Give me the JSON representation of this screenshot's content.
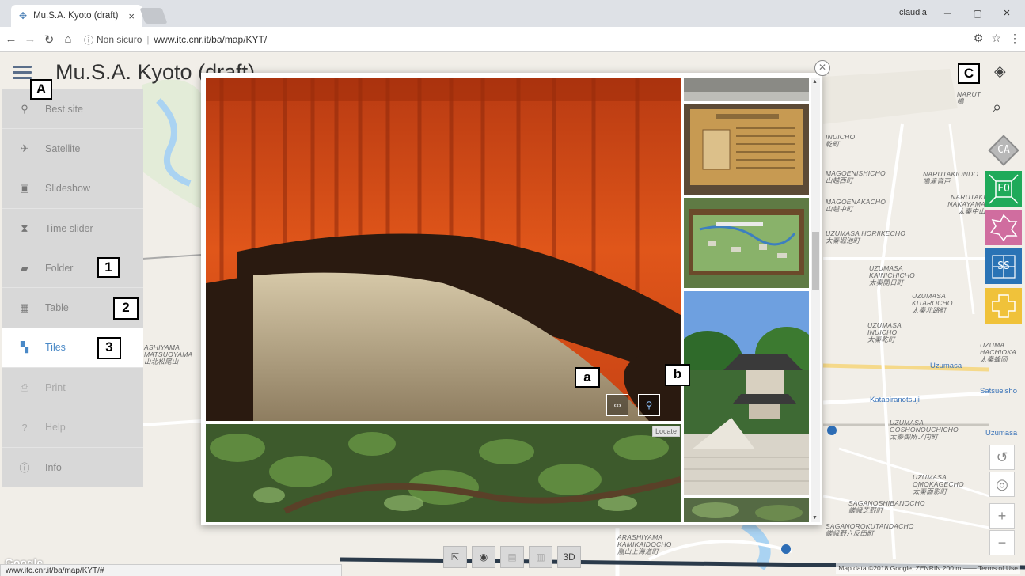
{
  "browser": {
    "tab_title": "Mu.S.A. Kyoto (draft)",
    "tab_close": "×",
    "user_name": "claudia",
    "minimize": "–",
    "restore": "▢",
    "close": "×",
    "security_label": "Non sicuro",
    "url": "www.itc.cnr.it/ba/map/KYT/",
    "status_url": "www.itc.cnr.it/ba/map/KYT/#"
  },
  "app": {
    "title": "Mu.S.A. Kyoto (draft)"
  },
  "sidebar": {
    "items": [
      {
        "label": "Best site",
        "icon": "pin-icon"
      },
      {
        "label": "Satellite",
        "icon": "satellite-icon"
      },
      {
        "label": "Slideshow",
        "icon": "slideshow-icon"
      },
      {
        "label": "Time slider",
        "icon": "hourglass-icon"
      },
      {
        "label": "Folder",
        "icon": "folder-icon"
      },
      {
        "label": "Table",
        "icon": "table-icon"
      },
      {
        "label": "Tiles",
        "icon": "tiles-icon"
      },
      {
        "label": "Print",
        "icon": "print-icon"
      },
      {
        "label": "Help",
        "icon": "help-icon"
      },
      {
        "label": "Info",
        "icon": "info-icon"
      }
    ],
    "active": "Tiles"
  },
  "callouts": {
    "A": "A",
    "C": "C",
    "one": "1",
    "two": "2",
    "three": "3",
    "a": "a",
    "b": "b"
  },
  "tools": [
    {
      "label": "CA",
      "color": "#a8a8a8"
    },
    {
      "label": "FO",
      "color": "#1faa5a"
    },
    {
      "label": "",
      "color": "#d06d9f"
    },
    {
      "label": "SS",
      "color": "#2a73b5"
    },
    {
      "label": "",
      "color": "#f0c23a"
    }
  ],
  "gallery": {
    "tooltip": "Locate"
  },
  "map": {
    "attribution": "Map data ©2018 Google, ZENRIN   200 m ⎯⎯⎯⎯  Terms of Use",
    "google": "Google",
    "labels": [
      {
        "text": "NARUT",
        "sub": "鳴"
      },
      {
        "text": "INUICHO",
        "sub": "乾町"
      },
      {
        "text": "MAGOENISHICHO",
        "sub": "山越西町"
      },
      {
        "text": "NARUTAKIONDO",
        "sub": "鳴滝音戸"
      },
      {
        "text": "MAGOENAKACHO",
        "sub": "山越中町"
      },
      {
        "text": "NARUTAKI NAKAYAMA",
        "sub": "太秦中山"
      },
      {
        "text": "UZUMASA HORIIKECHO",
        "sub": "太秦堀池町"
      },
      {
        "text": "UZUMASA KAINICHICHO",
        "sub": "太秦開日町"
      },
      {
        "text": "UZUMASA KITAROCHO",
        "sub": "太秦北路町"
      },
      {
        "text": "UZUMASA INUICHO",
        "sub": "太秦乾町"
      },
      {
        "text": "UZUMA HACHIOKA",
        "sub": "太秦蜂岡"
      },
      {
        "text": "ASHIYAMA MATSUOYAMA",
        "sub": "山北松尾山"
      },
      {
        "text": "UZUMASA GOSHONOUCHICHO",
        "sub": "太秦御所ノ内町"
      },
      {
        "text": "UZUMASA OMOKAGECHO",
        "sub": "太秦面影町"
      },
      {
        "text": "SAGANOSHIBANOCHO",
        "sub": "嵯峨芝野町"
      },
      {
        "text": "SAGANOROKUTANDACHO",
        "sub": "嵯峨野六反田町"
      },
      {
        "text": "ARASHIYAMA KAMIKAIDOCHO",
        "sub": "嵐山上海道町"
      }
    ],
    "stations": [
      "Uzumasa",
      "Katabiranotsuji",
      "Satsueisho",
      "Uzumasa"
    ]
  }
}
